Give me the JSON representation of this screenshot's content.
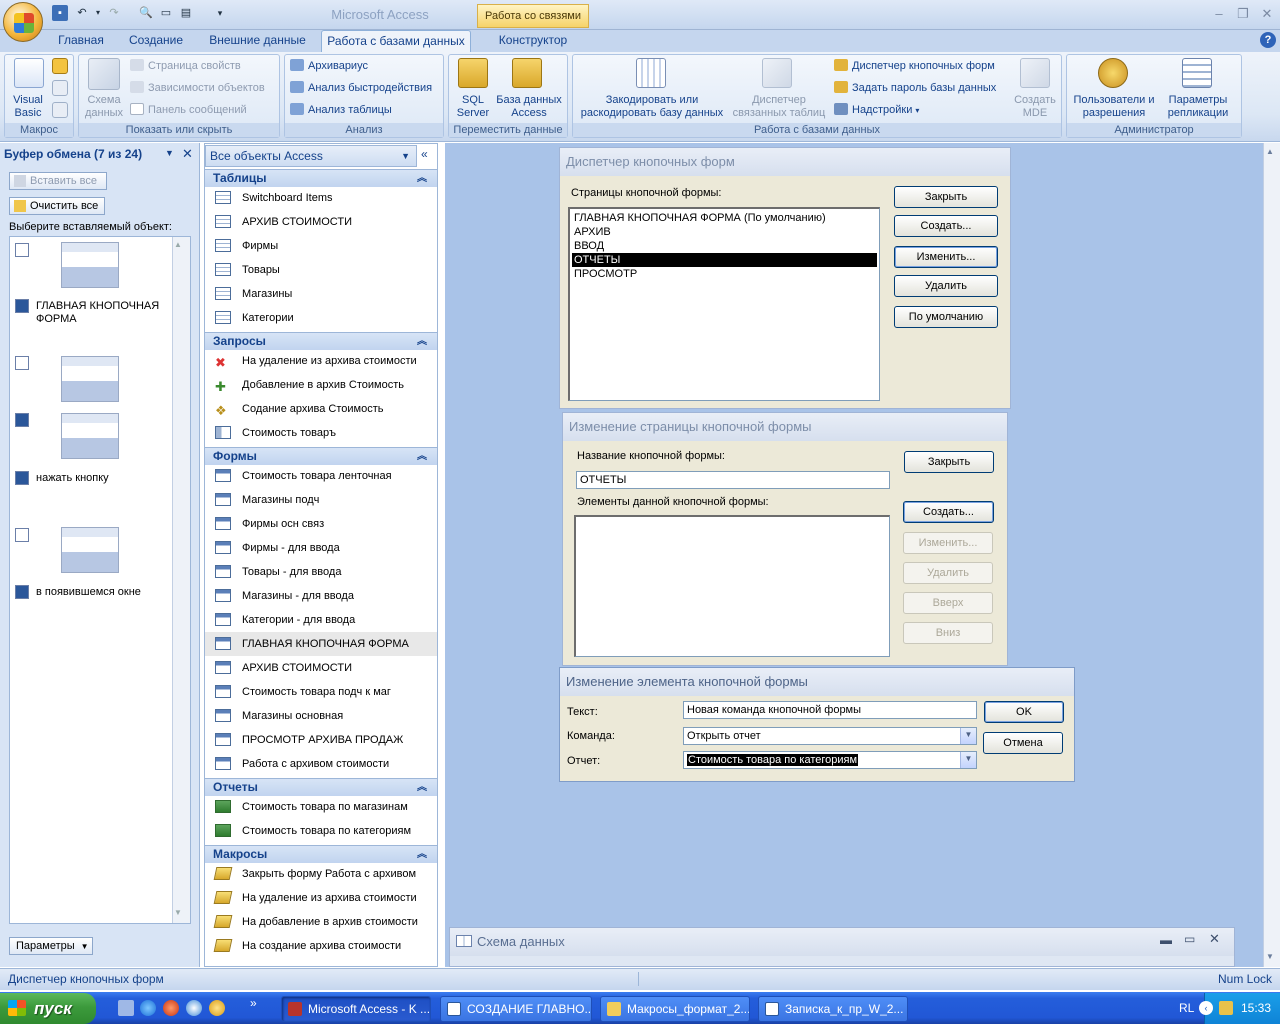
{
  "app": {
    "title": "Microsoft Access",
    "context_title": "Работа со связями"
  },
  "tabs": [
    "Главная",
    "Создание",
    "Внешние данные",
    "Работа с базами данных",
    "Конструктор"
  ],
  "ribbon": {
    "macro": {
      "label": "Макрос",
      "visual_basic": "Visual Basic"
    },
    "show_hide": {
      "label": "Показать или скрыть",
      "schema": "Схема данных",
      "props": "Страница свойств",
      "deps": "Зависимости объектов",
      "msgbar": "Панель сообщений"
    },
    "analysis": {
      "label": "Анализ",
      "archivist": "Архивариус",
      "perf": "Анализ быстродействия",
      "table": "Анализ таблицы"
    },
    "move": {
      "label": "Переместить данные",
      "sql": "SQL Server",
      "access": "База данных Access"
    },
    "db": {
      "label": "Работа с базами данных",
      "encode": "Закодировать или раскодировать базу данных",
      "linked": "Диспетчер связанных таблиц",
      "switchboard": "Диспетчер кнопочных форм",
      "password": "Задать пароль базы данных",
      "addins": "Надстройки",
      "mde": "Создать MDE"
    },
    "admin": {
      "label": "Администратор",
      "users": "Пользователи и разрешения",
      "replication": "Параметры репликации"
    }
  },
  "clipboard": {
    "title": "Буфер обмена (7 из 24)",
    "paste_all": "Вставить все",
    "clear_all": "Очистить все",
    "prompt": "Выберите вставляемый объект:",
    "items": [
      "ГЛАВНАЯ КНОПОЧНАЯ ФОРМА",
      "нажать кнопку",
      "в появившемся окне"
    ],
    "options": "Параметры"
  },
  "nav": {
    "title": "Все объекты Access",
    "sections": {
      "tables": "Таблицы",
      "queries": "Запросы",
      "forms": "Формы",
      "reports": "Отчеты",
      "macros": "Макросы"
    },
    "tables": [
      "Switchboard Items",
      "АРХИВ СТОИМОСТИ",
      "Фирмы",
      "Товары",
      "Магазины",
      "Категории"
    ],
    "queries": [
      "На удаление из архива стоимости",
      "Добавление в архив Стоимость",
      "Содание архива Стоимость",
      "Стоимость товаръ"
    ],
    "forms": [
      "Стоимость товара ленточная",
      "Магазины подч",
      "Фирмы осн связ",
      "Фирмы - для ввода",
      "Товары - для ввода",
      "Магазины - для ввода",
      "Категории - для ввода",
      "ГЛАВНАЯ КНОПОЧНАЯ ФОРМА",
      "АРХИВ СТОИМОСТИ",
      "Стоимость товара подч к маг",
      "Магазины основная",
      "ПРОСМОТР АРХИВА ПРОДАЖ",
      "Работа с архивом стоимости"
    ],
    "reports": [
      "Стоимость товара по магазинам",
      "Стоимость товара по категориям"
    ],
    "macros": [
      "Закрыть форму Работа с архивом",
      "На удаление из архива стоимости",
      "На добавление в архив стоимости",
      "На создание архива стоимости"
    ]
  },
  "dialog1": {
    "title": "Диспетчер кнопочных форм",
    "list_label": "Страницы кнопочной формы:",
    "pages": [
      "ГЛАВНАЯ КНОПОЧНАЯ ФОРМА (По умолчанию)",
      "АРХИВ",
      "ВВОД",
      "ОТЧЕТЫ",
      "ПРОСМОТР"
    ],
    "selected_index": 3,
    "buttons": {
      "close": "Закрыть",
      "create": "Создать...",
      "edit": "Изменить...",
      "delete": "Удалить",
      "default": "По умолчанию"
    }
  },
  "dialog2": {
    "title": "Изменение страницы кнопочной формы",
    "name_label": "Название кнопочной формы:",
    "name_value": "ОТЧЕТЫ",
    "items_label": "Элементы данной кнопочной формы:",
    "buttons": {
      "close": "Закрыть",
      "create": "Создать...",
      "edit": "Изменить...",
      "delete": "Удалить",
      "up": "Вверх",
      "down": "Вниз"
    }
  },
  "dialog3": {
    "title": "Изменение элемента кнопочной формы",
    "text_label": "Текст:",
    "text_value": "Новая команда кнопочной формы",
    "command_label": "Команда:",
    "command_value": "Открыть отчет",
    "report_label": "Отчет:",
    "report_value": "Стоимость товара по категориям",
    "ok": "OK",
    "cancel": "Отмена"
  },
  "schema_window": {
    "title": "Схема данных"
  },
  "status": {
    "text": "Диспетчер кнопочных форм",
    "numlock": "Num Lock"
  },
  "taskbar": {
    "start": "пуск",
    "tasks": [
      "Microsoft Access - K ...",
      "СОЗДАНИЕ ГЛАВНО...",
      "Макросы_формат_2...",
      "Записка_к_пр_W_2..."
    ],
    "lang": "RL",
    "time": "15:33"
  }
}
